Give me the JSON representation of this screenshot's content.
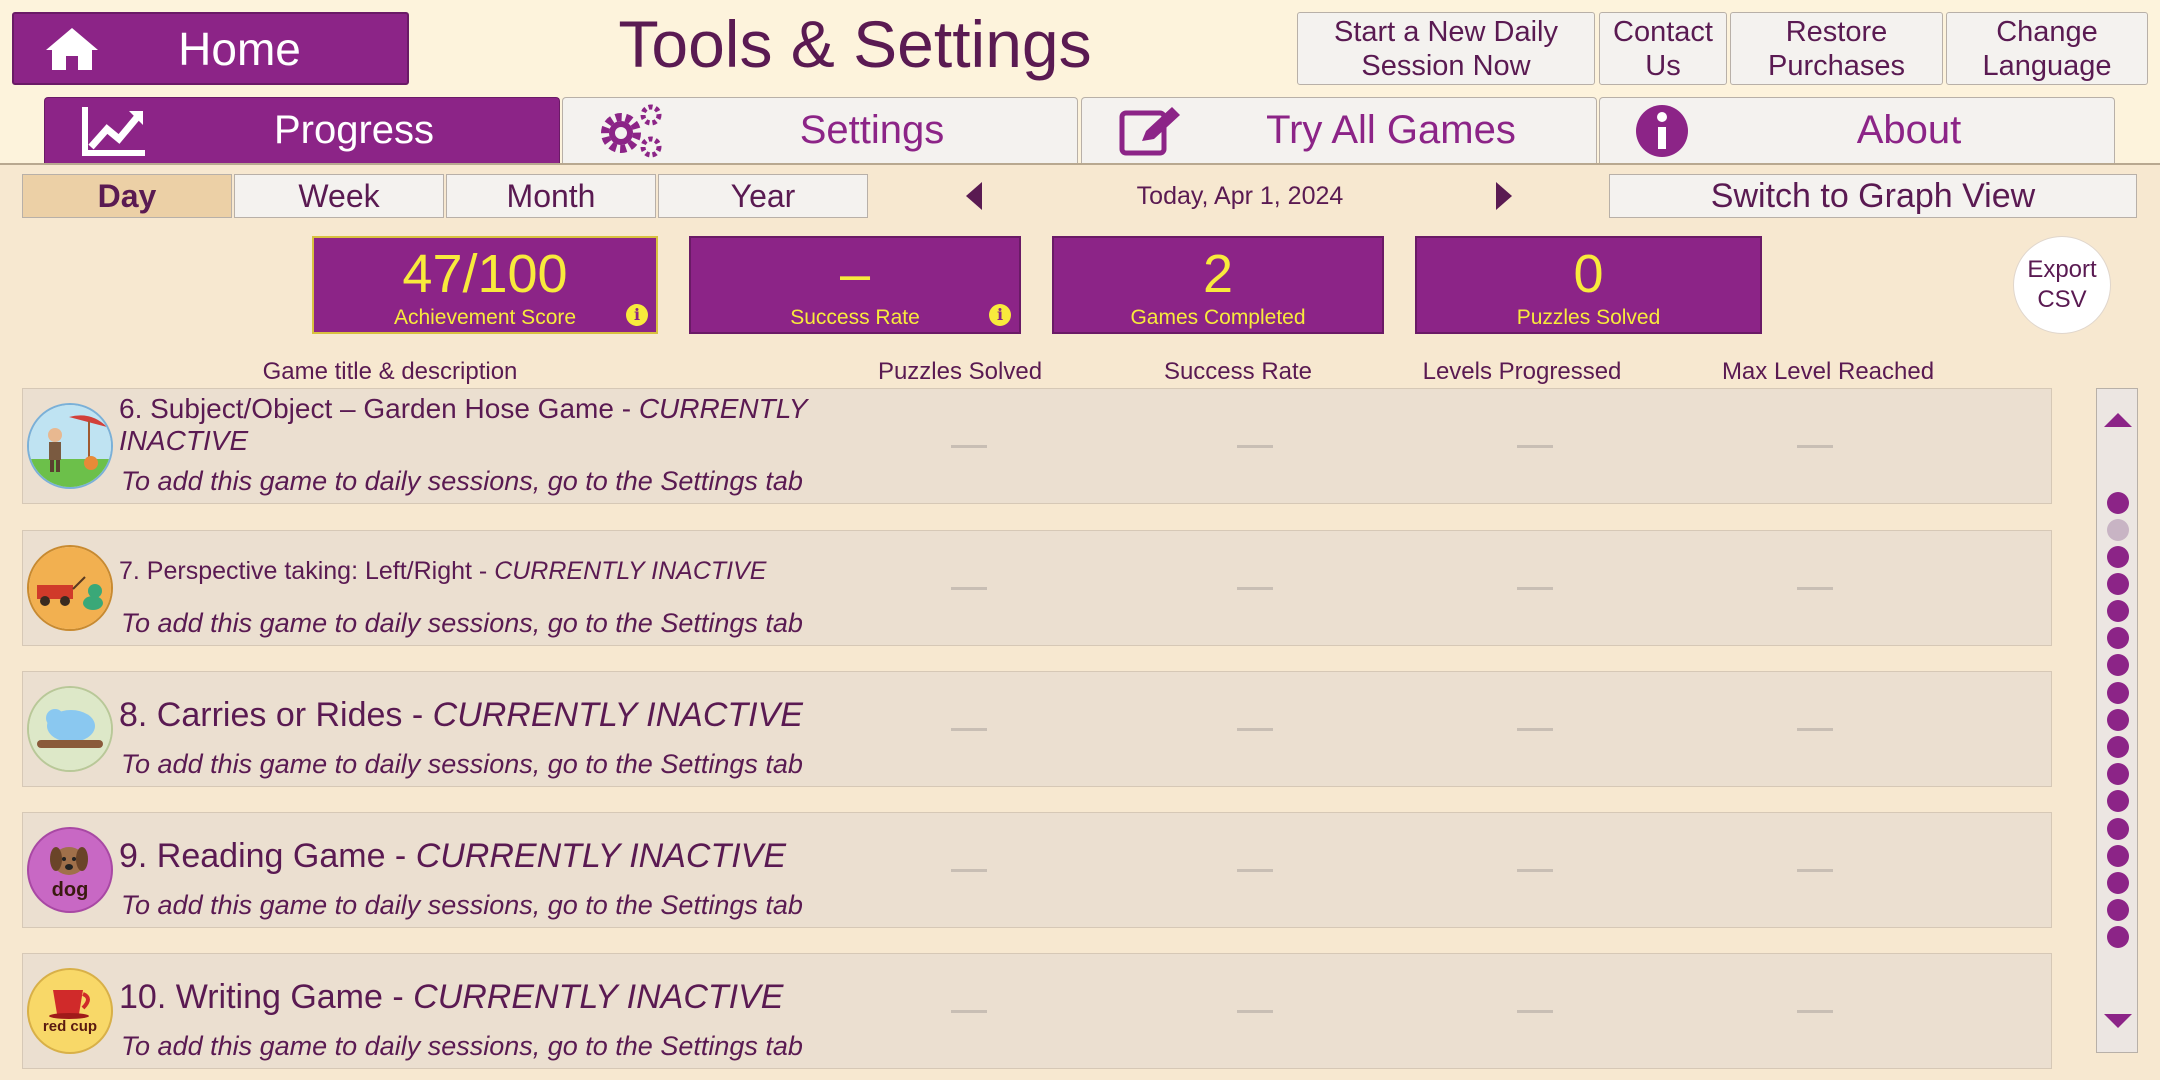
{
  "header": {
    "home_label": "Home",
    "title": "Tools & Settings",
    "buttons": [
      {
        "label": "Start a New Daily\nSession Now"
      },
      {
        "label": "Contact\nUs"
      },
      {
        "label": "Restore\nPurchases"
      },
      {
        "label": "Change\nLanguage"
      }
    ]
  },
  "tabs": [
    {
      "label": "Progress",
      "icon": "chart-trend-icon",
      "active": true
    },
    {
      "label": "Settings",
      "icon": "gears-icon",
      "active": false
    },
    {
      "label": "Try All Games",
      "icon": "edit-icon",
      "active": false
    },
    {
      "label": "About",
      "icon": "info-icon",
      "active": false
    }
  ],
  "periods": [
    {
      "label": "Day",
      "active": true
    },
    {
      "label": "Week",
      "active": false
    },
    {
      "label": "Month",
      "active": false
    },
    {
      "label": "Year",
      "active": false
    }
  ],
  "date_label": "Today, Apr 1, 2024",
  "graph_button": "Switch to Graph View",
  "stats": [
    {
      "value": "47/100",
      "label": "Achievement Score",
      "info": true
    },
    {
      "value": "–",
      "label": "Success Rate",
      "info": true
    },
    {
      "value": "2",
      "label": "Games Completed",
      "info": false
    },
    {
      "value": "0",
      "label": "Puzzles Solved",
      "info": false
    }
  ],
  "export_label": "Export\nCSV",
  "columns": {
    "title": "Game title & description",
    "puzzles": "Puzzles Solved",
    "success": "Success Rate",
    "levels": "Levels Progressed",
    "max_level": "Max Level Reached"
  },
  "rows": [
    {
      "title": "6. Subject/Object – Garden Hose Game - ",
      "status": "CURRENTLY INACTIVE",
      "subtitle": "To add this game to daily sessions, go to the Settings tab",
      "icon": "garden-hose-icon"
    },
    {
      "title": "7. Perspective taking: Left/Right - ",
      "status": "CURRENTLY INACTIVE",
      "subtitle": "To add this game to daily sessions, go to the Settings tab",
      "icon": "wagon-duck-icon"
    },
    {
      "title": "8. Carries or Rides - ",
      "status": "CURRENTLY INACTIVE",
      "subtitle": "To add this game to daily sessions, go to the Settings tab",
      "icon": "hippo-icon"
    },
    {
      "title": "9. Reading Game - ",
      "status": "CURRENTLY INACTIVE",
      "subtitle": "To add this game to daily sessions, go to the Settings tab",
      "icon": "dog-icon",
      "icon_text": "dog"
    },
    {
      "title": "10. Writing Game - ",
      "status": "CURRENTLY INACTIVE",
      "subtitle": "To add this game to daily sessions, go to the Settings tab",
      "icon": "red-cup-icon",
      "icon_text": "red cup"
    }
  ],
  "colors": {
    "accent": "#8c2487",
    "stat_text": "#f8ea3c",
    "background": "#fdf3dc"
  }
}
